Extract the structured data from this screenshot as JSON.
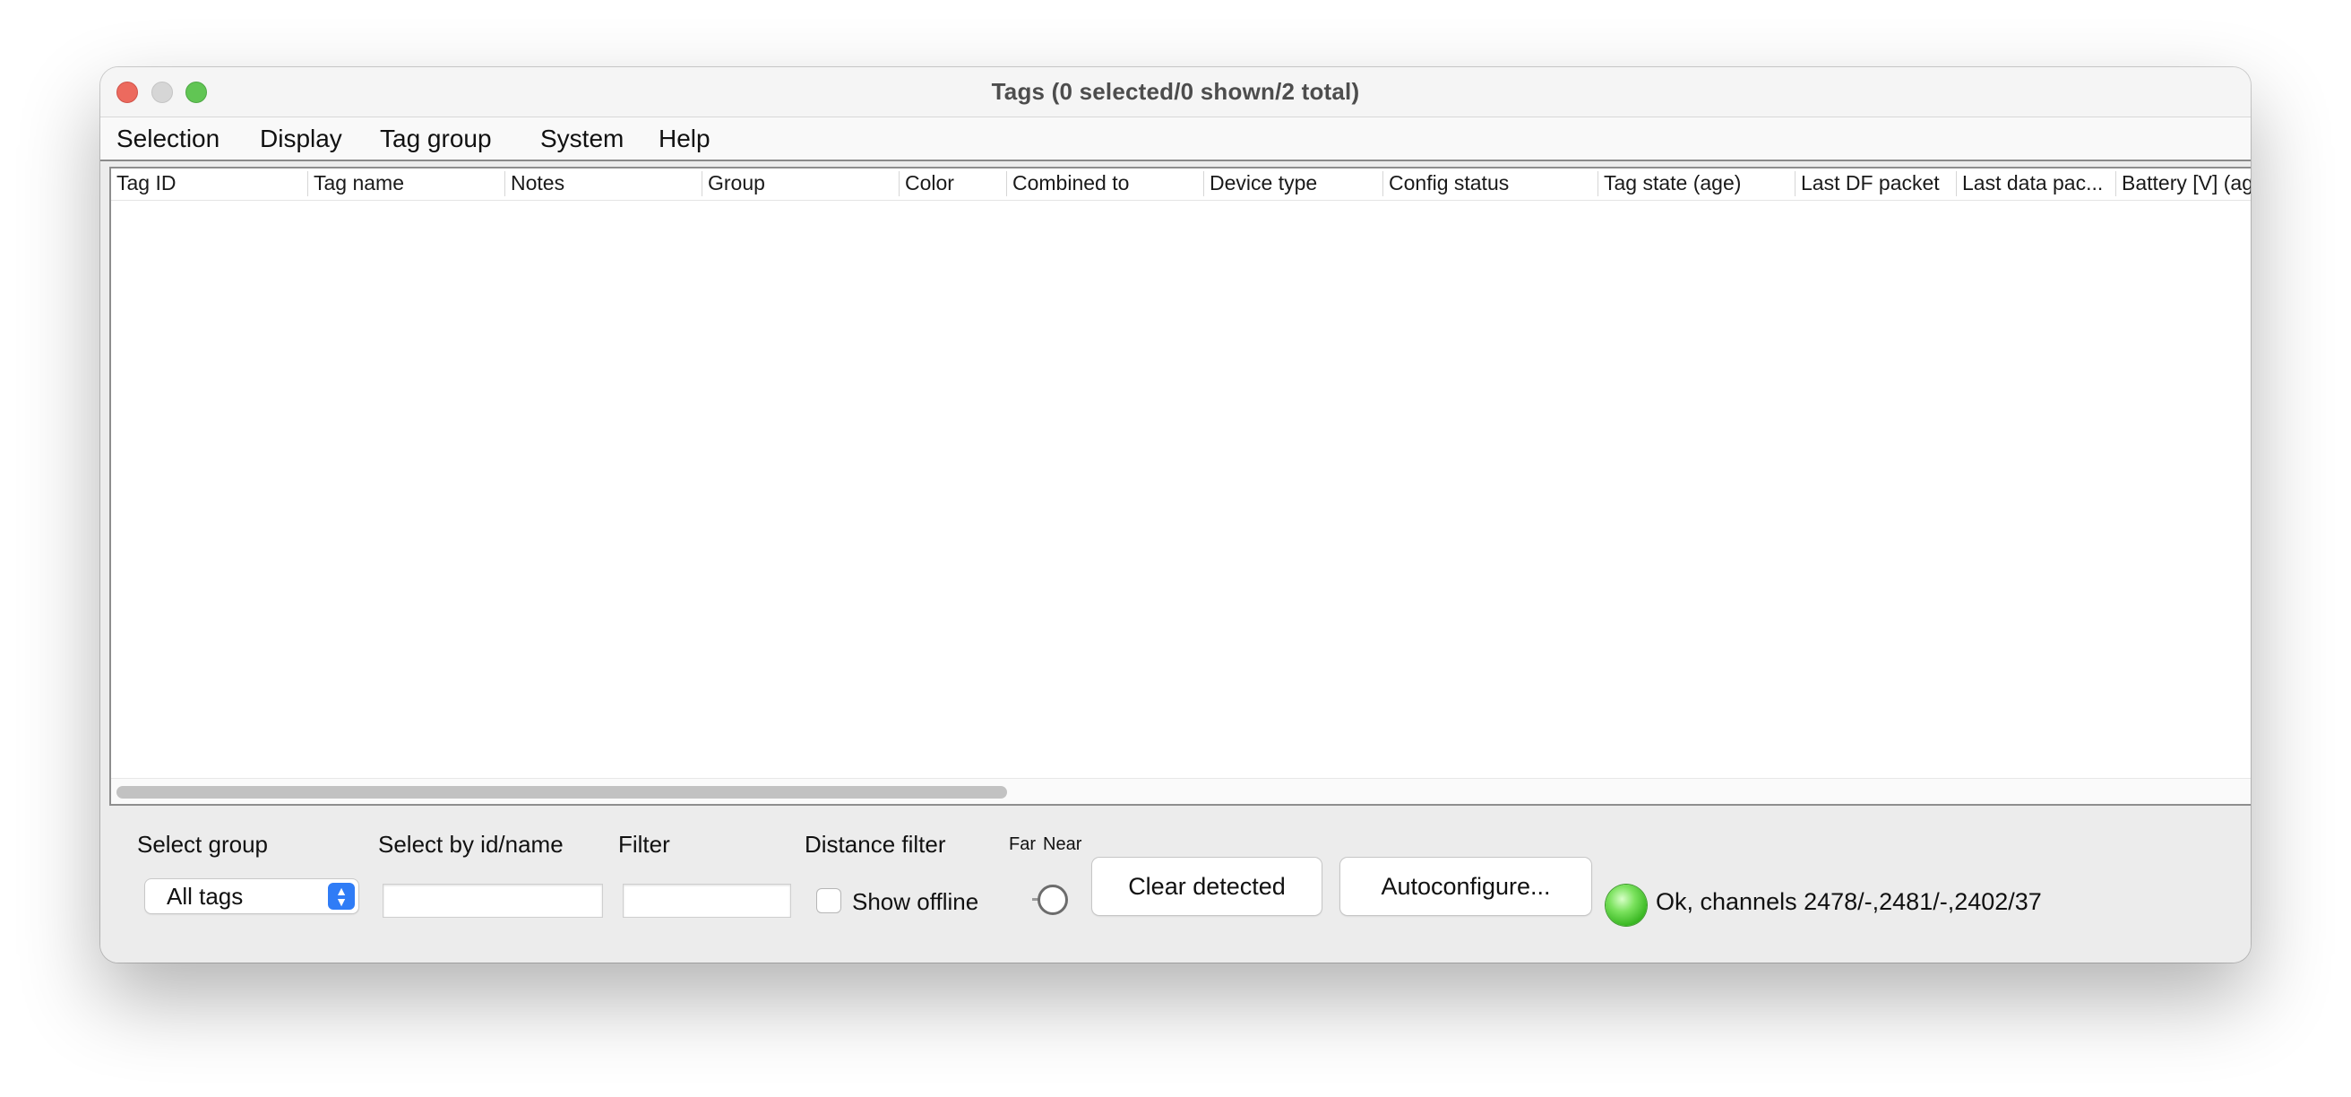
{
  "window": {
    "title": "Tags (0 selected/0 shown/2 total)"
  },
  "menubar": {
    "items": [
      {
        "label": "Selection"
      },
      {
        "label": "Display"
      },
      {
        "label": "Tag group"
      },
      {
        "label": "System"
      },
      {
        "label": "Help"
      }
    ]
  },
  "table": {
    "columns": [
      "Tag ID",
      "Tag name",
      "Notes",
      "Group",
      "Color",
      "Combined to",
      "Device type",
      "Config status",
      "Tag state (age)",
      "Last DF packet",
      "Last data pac...",
      "Battery [V] (ag"
    ],
    "rows": []
  },
  "controls": {
    "select_group_label": "Select group",
    "select_group_value": "All tags",
    "select_by_label": "Select by id/name",
    "select_by_value": "",
    "filter_label": "Filter",
    "filter_value": "",
    "distance_filter_label": "Distance filter",
    "show_offline_label": "Show offline",
    "show_offline_checked": false,
    "slider_far_label": "Far",
    "slider_near_label": "Near",
    "clear_detected_label": "Clear detected",
    "autoconfigure_label": "Autoconfigure...",
    "status_text": "Ok, channels 2478/-,2481/-,2402/37",
    "status_color": "#4cc832"
  }
}
